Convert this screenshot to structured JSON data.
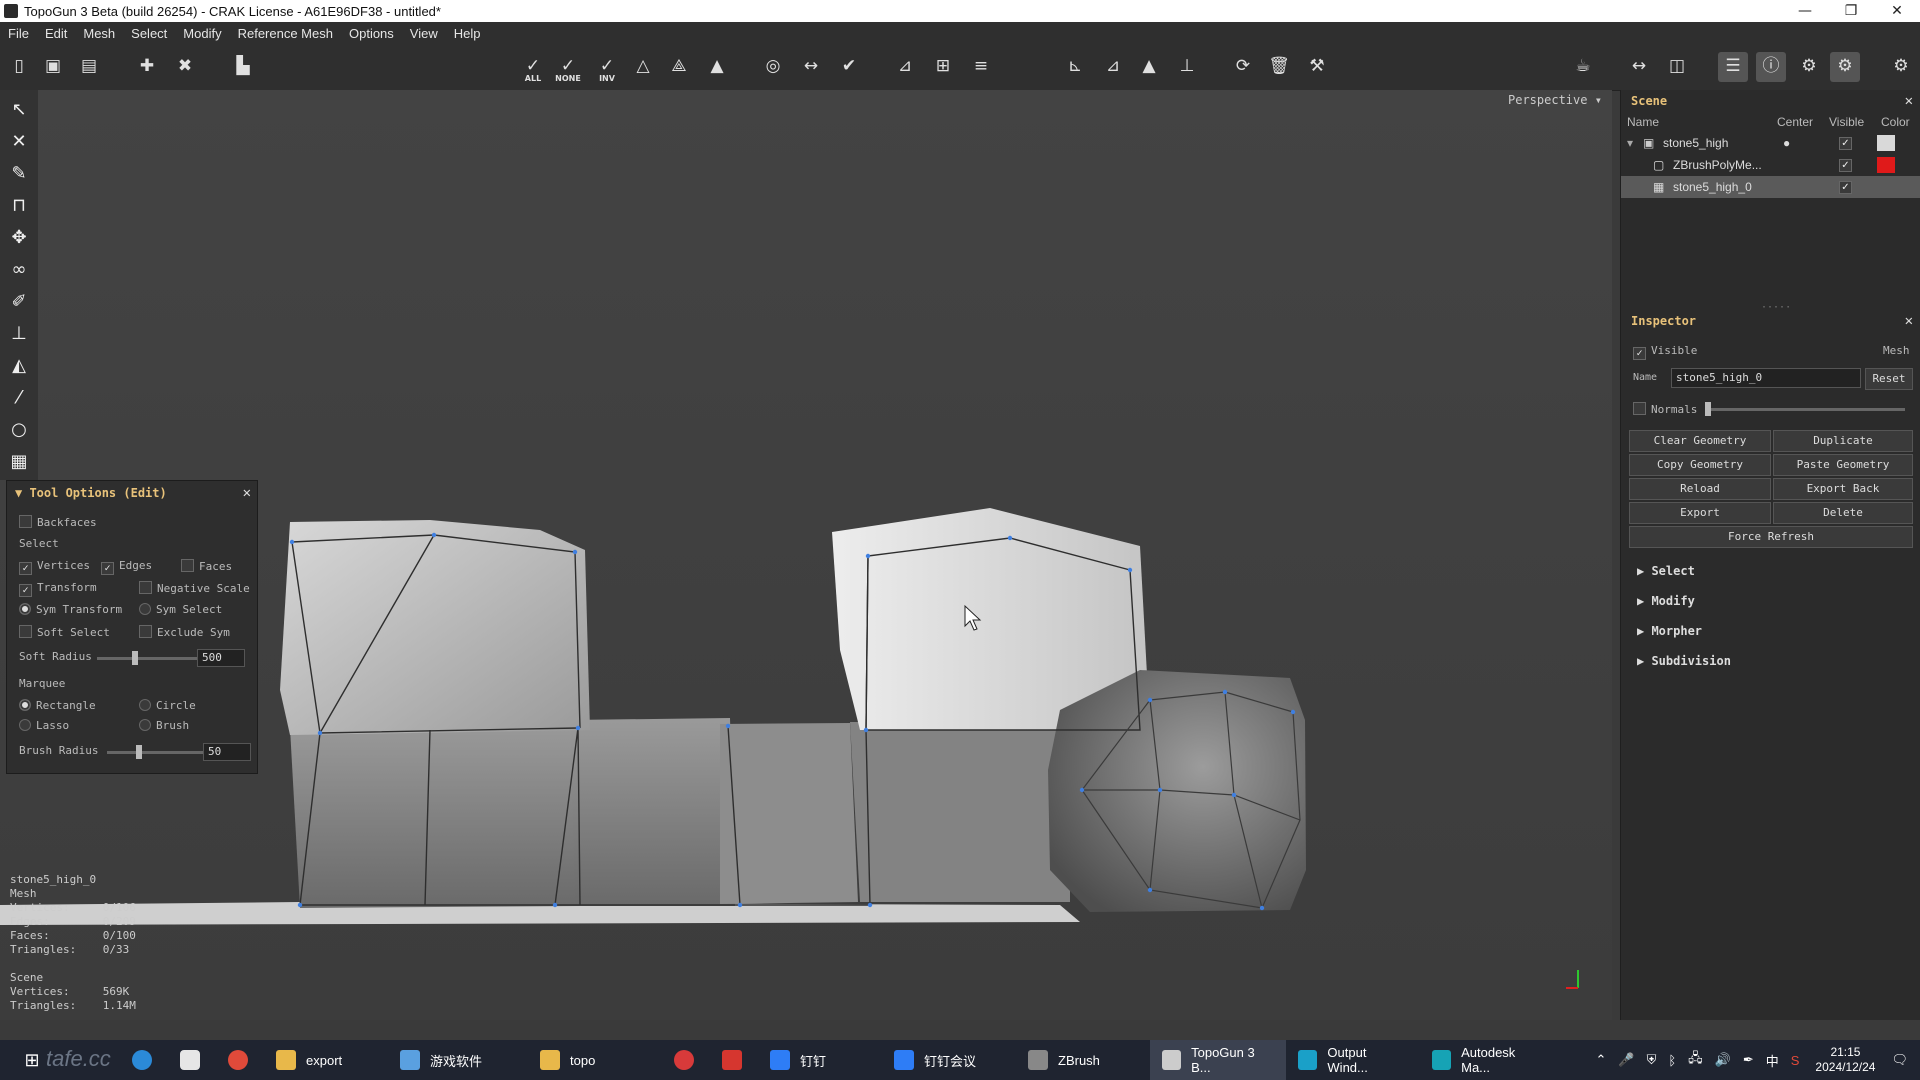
{
  "window": {
    "title": "TopoGun 3 Beta (build 26254) - CRAK License - A61E96DF38 - untitled*",
    "controls": [
      "—",
      "❐",
      "✕"
    ]
  },
  "menu": [
    "File",
    "Edit",
    "Mesh",
    "Select",
    "Modify",
    "Reference Mesh",
    "Options",
    "View",
    "Help"
  ],
  "toolbar": {
    "sel_all": "ALL",
    "sel_none": "NONE",
    "sel_inv": "INV"
  },
  "viewport": {
    "mode": "Perspective"
  },
  "tool_options": {
    "title": "Tool Options (Edit)",
    "backfaces": "Backfaces",
    "select_label": "Select",
    "vertices": "Vertices",
    "edges": "Edges",
    "faces": "Faces",
    "transform": "Transform",
    "negative_scale": "Negative Scale",
    "sym_transform": "Sym Transform",
    "sym_select": "Sym Select",
    "soft_select": "Soft Select",
    "exclude_sym": "Exclude Sym",
    "soft_radius_label": "Soft Radius",
    "soft_radius_value": "500",
    "soft_radius_fraction": 0.35,
    "marquee_label": "Marquee",
    "rectangle": "Rectangle",
    "circle": "Circle",
    "lasso": "Lasso",
    "brush": "Brush",
    "brush_radius_label": "Brush Radius",
    "brush_radius_value": "50",
    "brush_radius_fraction": 0.3
  },
  "stats": {
    "text": "stone5_high_0\nMesh\nVertices:     0/106\nEdges:        0/209\nFaces:        0/100\nTriangles:    0/33\n\nScene\nVertices:     569K\nTriangles:    1.14M"
  },
  "scene": {
    "title": "Scene",
    "col_name": "Name",
    "col_center": "Center",
    "col_visible": "Visible",
    "col_color": "Color",
    "items": [
      {
        "name": "stone5_high",
        "color": "#d9d9d9"
      },
      {
        "name": "ZBrushPolyMe...",
        "color": "#e01a1a"
      },
      {
        "name": "stone5_high_0",
        "color": ""
      }
    ]
  },
  "inspector": {
    "title": "Inspector",
    "visible": "Visible",
    "type": "Mesh",
    "name_label": "Name",
    "name_value": "stone5_high_0",
    "reset": "Reset",
    "normals": "Normals",
    "buttons": [
      "Clear Geometry",
      "Duplicate",
      "Copy Geometry",
      "Paste Geometry",
      "Reload",
      "Export Back",
      "Export",
      "Delete"
    ],
    "force_refresh": "Force Refresh",
    "sections": [
      "Select",
      "Modify",
      "Morpher",
      "Subdivision"
    ]
  },
  "taskbar": {
    "items": [
      {
        "label": "export",
        "color": "#e8b84a"
      },
      {
        "label": "游戏软件",
        "color": "#5aa0e0"
      },
      {
        "label": "topo",
        "color": "#e8b84a"
      },
      {
        "label": "钉钉",
        "color": "#2e7df6"
      },
      {
        "label": "钉钉会议",
        "color": "#2e7df6"
      },
      {
        "label": "ZBrush",
        "color": "#888888"
      },
      {
        "label": "TopoGun 3 B...",
        "color": "#cccccc"
      },
      {
        "label": "Output Wind...",
        "color": "#1aa0c8"
      },
      {
        "label": "Autodesk Ma...",
        "color": "#16a3b5"
      }
    ],
    "time": "21:15",
    "date": "2024/12/24",
    "ime": "中",
    "watermark": "tafe.cc"
  }
}
